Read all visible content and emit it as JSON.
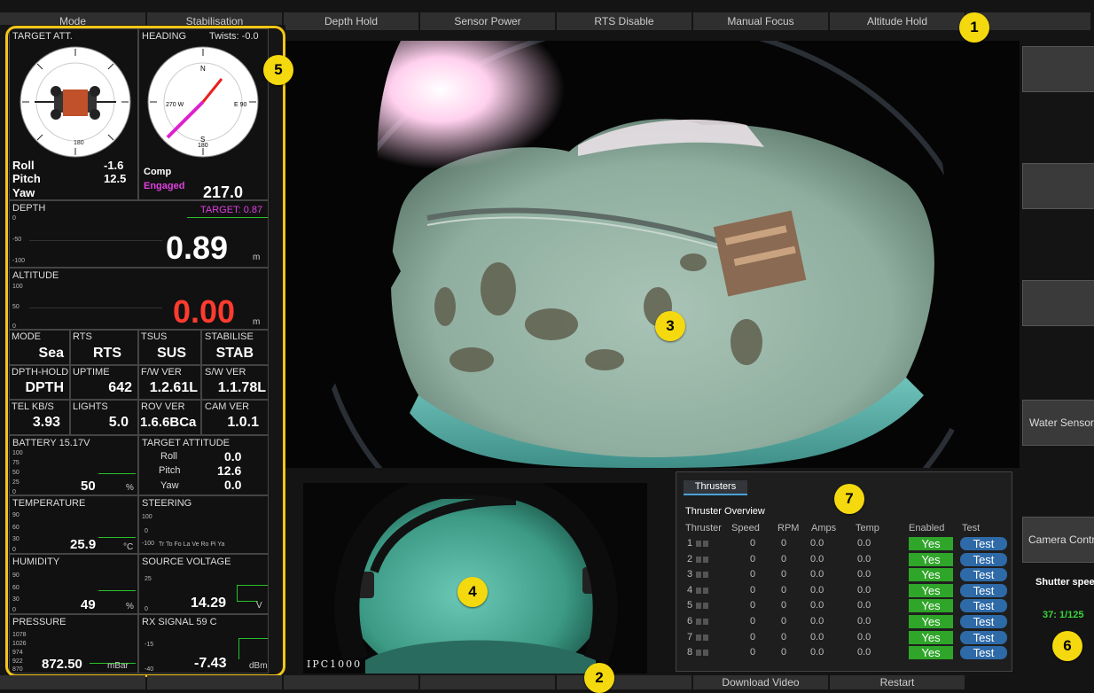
{
  "top_buttons": [
    "Mode",
    "Stabilisation",
    "Depth Hold",
    "Sensor Power",
    "RTS Disable",
    "Manual Focus",
    "Altitude Hold",
    ""
  ],
  "bottom_buttons": [
    "",
    "",
    "",
    "",
    "",
    "Download Video",
    "Restart"
  ],
  "callouts": [
    "1",
    "2",
    "3",
    "4",
    "5",
    "6",
    "7"
  ],
  "target_att": {
    "label": "TARGET ATT.",
    "roll_label": "Roll",
    "roll": "-1.6",
    "pitch_label": "Pitch",
    "pitch": "12.5",
    "yaw_label": "Yaw"
  },
  "heading": {
    "label": "HEADING",
    "twists": "Twists: -0.0",
    "comp": "Comp",
    "engaged": "Engaged",
    "value": "217.0",
    "n": "N",
    "e": "E 90",
    "s": "S",
    "w": "270 W",
    "s180": "180"
  },
  "depth": {
    "label": "DEPTH",
    "target": "TARGET: 0.87",
    "value": "0.89",
    "unit": "m",
    "ticks": [
      "0",
      "-50",
      "-100"
    ]
  },
  "altitude": {
    "label": "ALTITUDE",
    "value": "0.00",
    "unit": "m",
    "ticks": [
      "100",
      "50",
      "0"
    ]
  },
  "stats": [
    {
      "label": "MODE",
      "value": "Sea"
    },
    {
      "label": "RTS",
      "value": "RTS"
    },
    {
      "label": "TSUS",
      "value": "SUS"
    },
    {
      "label": "STABILISE",
      "value": "STAB"
    },
    {
      "label": "DPTH-HOLD",
      "value": "DPTH"
    },
    {
      "label": "UPTIME",
      "value": "642"
    },
    {
      "label": "F/W VER",
      "value": "1.2.61L"
    },
    {
      "label": "S/W VER",
      "value": "1.1.78L"
    },
    {
      "label": "TEL KB/S",
      "value": "3.93"
    },
    {
      "label": "LIGHTS",
      "value": "5.0"
    },
    {
      "label": "ROV VER",
      "value": "1.6.6BCa"
    },
    {
      "label": "CAM VER",
      "value": "1.0.1"
    }
  ],
  "battery": {
    "label": "BATTERY 15.17V",
    "value": "50",
    "unit": "%",
    "ticks": [
      "100",
      "75",
      "50",
      "25",
      "0"
    ]
  },
  "target_attitude": {
    "label": "TARGET ATTITUDE",
    "roll_label": "Roll",
    "roll": "0.0",
    "pitch_label": "Pitch",
    "pitch": "12.6",
    "yaw_label": "Yaw",
    "yaw": "0.0"
  },
  "temperature": {
    "label": "TEMPERATURE",
    "value": "25.9",
    "unit": "°C",
    "ticks": [
      "90",
      "60",
      "30",
      "0"
    ]
  },
  "steering": {
    "label": "STEERING",
    "ticks": [
      "100",
      "0",
      "-100"
    ],
    "axis": "Tr  To  Fo  La  Ve  Ro  Pi  Ya"
  },
  "humidity": {
    "label": "HUMIDITY",
    "value": "49",
    "unit": "%",
    "ticks": [
      "90",
      "60",
      "30",
      "0"
    ]
  },
  "source_voltage": {
    "label": "SOURCE VOLTAGE",
    "value": "14.29",
    "unit": "V",
    "ticks": [
      "25",
      "0"
    ]
  },
  "pressure": {
    "label": "PRESSURE",
    "value": "872.50",
    "unit": "mBar",
    "ticks": [
      "1078",
      "1026",
      "974",
      "922",
      "870"
    ]
  },
  "rx_signal": {
    "label": "RX SIGNAL 59 C",
    "value": "-7.43",
    "unit": "dBm",
    "ticks": [
      "-15",
      "-40"
    ]
  },
  "right_buttons": [
    "",
    "",
    "",
    "Water Sensor",
    "Camera Control"
  ],
  "shutter": {
    "label": "Shutter speed",
    "value": "37: 1/125"
  },
  "small_cam_text": "IPC1000",
  "thrusters": {
    "tab": "Thrusters",
    "title": "Thruster Overview",
    "headers": [
      "Thruster",
      "Speed",
      "RPM",
      "Amps",
      "Temp",
      "Enabled",
      "Test"
    ],
    "rows": [
      {
        "id": "1",
        "speed": "0",
        "rpm": "0",
        "amps": "0.0",
        "temp": "0.0",
        "enabled": "Yes",
        "test": "Test"
      },
      {
        "id": "2",
        "speed": "0",
        "rpm": "0",
        "amps": "0.0",
        "temp": "0.0",
        "enabled": "Yes",
        "test": "Test"
      },
      {
        "id": "3",
        "speed": "0",
        "rpm": "0",
        "amps": "0.0",
        "temp": "0.0",
        "enabled": "Yes",
        "test": "Test"
      },
      {
        "id": "4",
        "speed": "0",
        "rpm": "0",
        "amps": "0.0",
        "temp": "0.0",
        "enabled": "Yes",
        "test": "Test"
      },
      {
        "id": "5",
        "speed": "0",
        "rpm": "0",
        "amps": "0.0",
        "temp": "0.0",
        "enabled": "Yes",
        "test": "Test"
      },
      {
        "id": "6",
        "speed": "0",
        "rpm": "0",
        "amps": "0.0",
        "temp": "0.0",
        "enabled": "Yes",
        "test": "Test"
      },
      {
        "id": "7",
        "speed": "0",
        "rpm": "0",
        "amps": "0.0",
        "temp": "0.0",
        "enabled": "Yes",
        "test": "Test"
      },
      {
        "id": "8",
        "speed": "0",
        "rpm": "0",
        "amps": "0.0",
        "temp": "0.0",
        "enabled": "Yes",
        "test": "Test"
      }
    ]
  },
  "colors": {
    "highlight": "#f5c518",
    "target": "#e040e0",
    "alt_value": "#ff3b2f",
    "green": "#2fa529",
    "blue": "#2e6aa8",
    "shutter": "#39d539"
  }
}
